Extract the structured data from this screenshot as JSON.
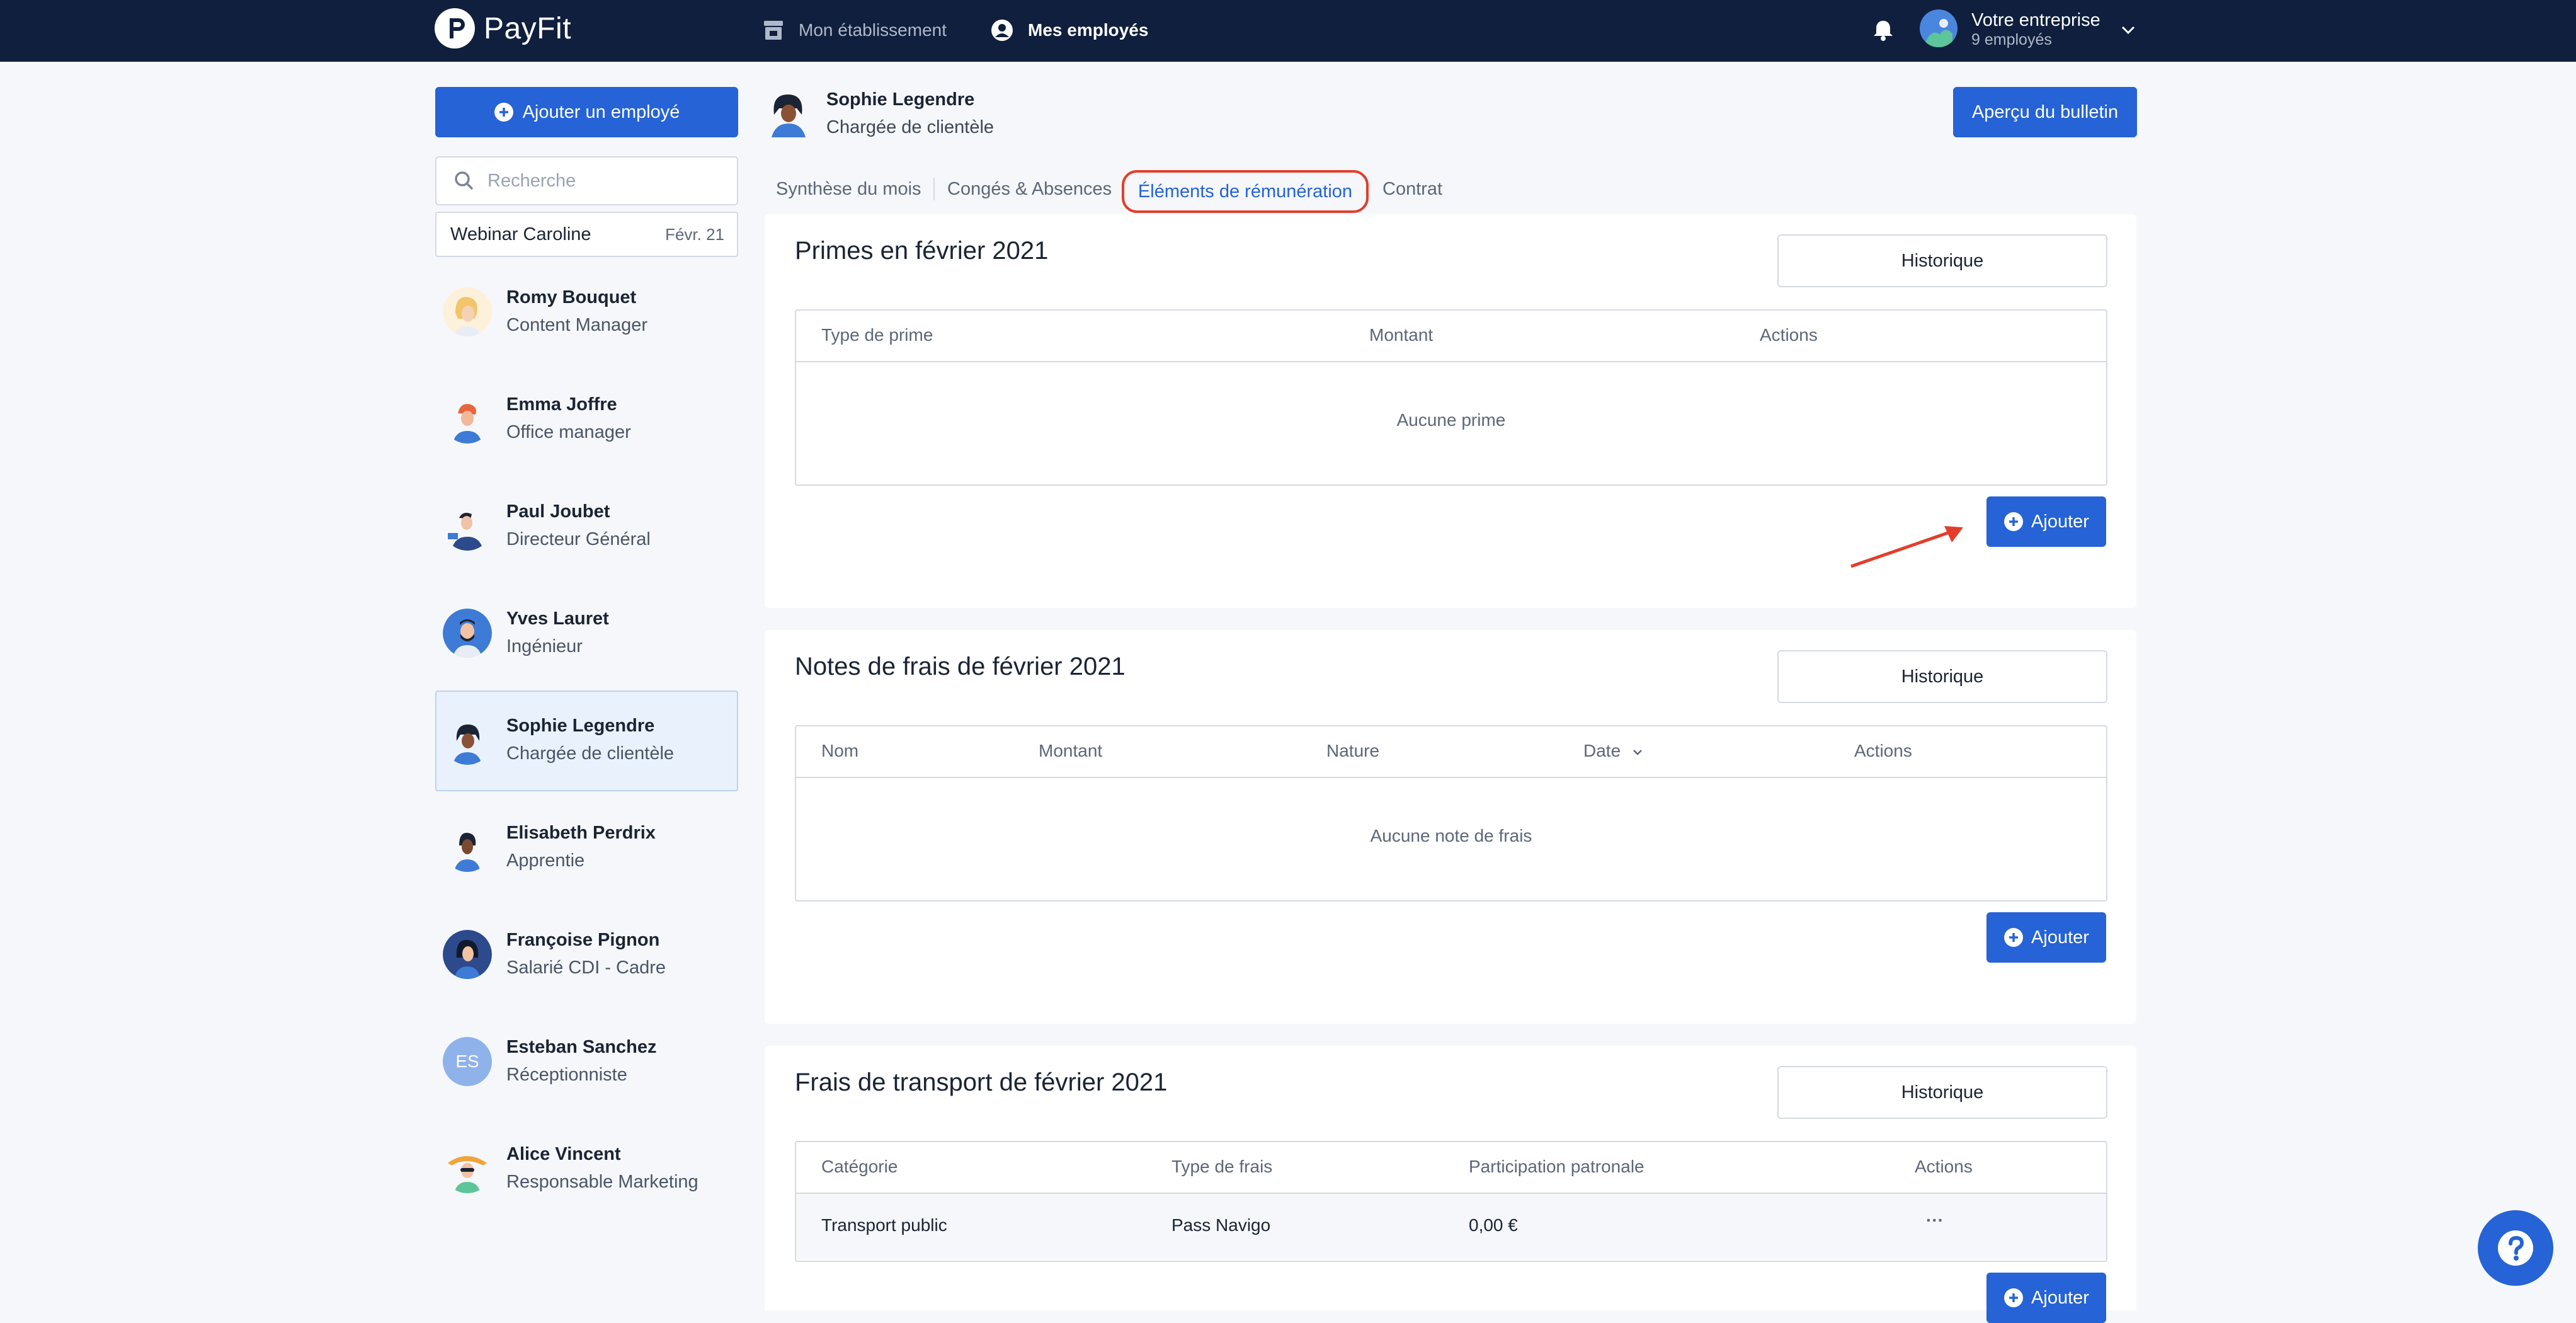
{
  "app": {
    "logo_text": "PayFit",
    "nav": [
      {
        "label": "Mon établissement",
        "icon": "store-icon"
      },
      {
        "label": "Mes employés",
        "icon": "user-circle-icon"
      }
    ],
    "company": {
      "name": "Votre entreprise",
      "count": "9 employés"
    }
  },
  "sidebar": {
    "add_button": "Ajouter un employé",
    "search_placeholder": "Recherche",
    "filter": {
      "name": "Webinar Caroline",
      "date": "Févr. 21"
    },
    "employees": [
      {
        "name": "Romy Bouquet",
        "role": "Content Manager"
      },
      {
        "name": "Emma Joffre",
        "role": "Office manager"
      },
      {
        "name": "Paul Joubet",
        "role": "Directeur Général"
      },
      {
        "name": "Yves Lauret",
        "role": "Ingénieur"
      },
      {
        "name": "Sophie Legendre",
        "role": "Chargée de clientèle",
        "selected": true
      },
      {
        "name": "Elisabeth Perdrix",
        "role": "Apprentie"
      },
      {
        "name": "Françoise Pignon",
        "role": "Salarié CDI - Cadre"
      },
      {
        "name": "Esteban Sanchez",
        "role": "Réceptionniste",
        "initials": "ES"
      },
      {
        "name": "Alice Vincent",
        "role": "Responsable Marketing"
      }
    ]
  },
  "header": {
    "name": "Sophie Legendre",
    "role": "Chargée de clientèle",
    "preview_button": "Aperçu du bulletin"
  },
  "tabs": [
    {
      "label": "Synthèse du mois"
    },
    {
      "label": "Congés & Absences"
    },
    {
      "label": "Éléments de rémunération",
      "active": true
    },
    {
      "label": "Contrat"
    }
  ],
  "primes": {
    "title": "Primes en février 2021",
    "history_button": "Historique",
    "columns": [
      "Type de prime",
      "Montant",
      "Actions"
    ],
    "empty": "Aucune prime",
    "add_button": "Ajouter"
  },
  "notes": {
    "title": "Notes de frais de février 2021",
    "history_button": "Historique",
    "columns": [
      "Nom",
      "Montant",
      "Nature",
      "Date",
      "Actions"
    ],
    "empty": "Aucune note de frais",
    "add_button": "Ajouter"
  },
  "transport": {
    "title": "Frais de transport de février 2021",
    "history_button": "Historique",
    "columns": [
      "Catégorie",
      "Type de frais",
      "Participation patronale",
      "Actions"
    ],
    "rows": [
      {
        "categorie": "Transport public",
        "type": "Pass Navigo",
        "participation": "0,00 €",
        "actions": "···"
      }
    ],
    "add_button": "Ajouter"
  },
  "colors": {
    "topbar": "#0f1f3d",
    "primary": "#2563d6",
    "highlight": "#e43d2b",
    "selected_bg": "#e9f1fc"
  }
}
